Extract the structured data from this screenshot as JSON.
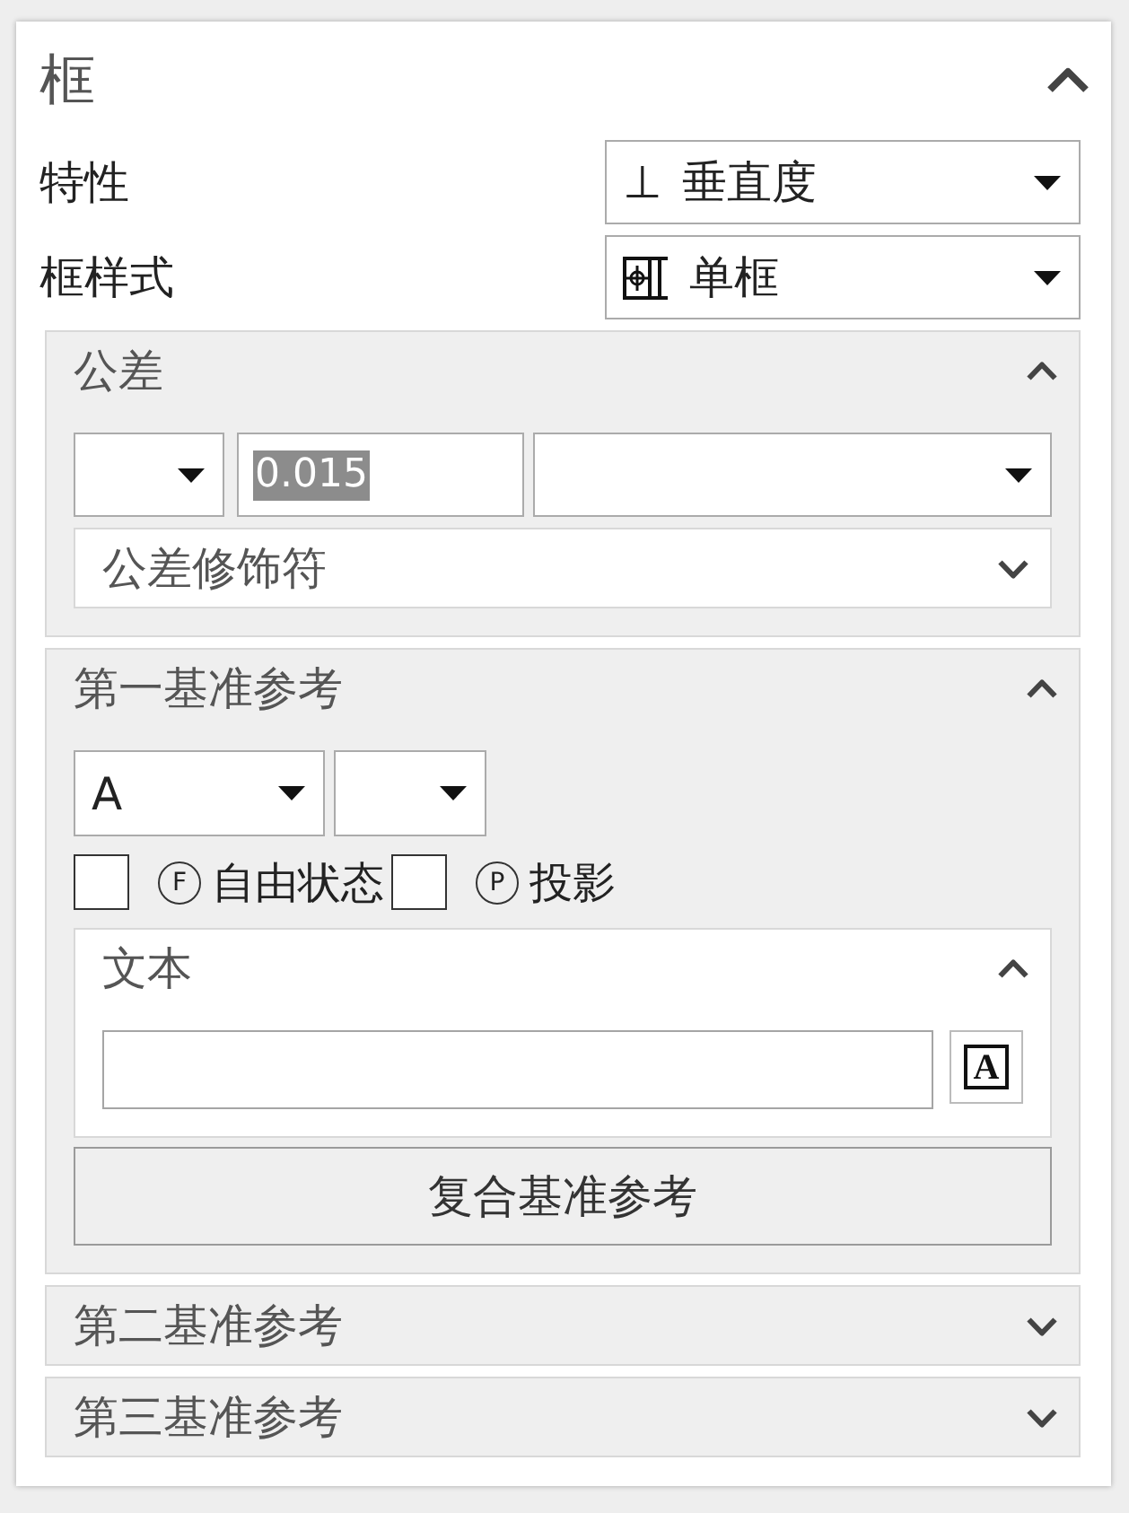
{
  "panel": {
    "title": "框",
    "expanded": true
  },
  "fields": [
    {
      "label": "特性",
      "kind": "symbol",
      "symbol": "⊥",
      "value": "垂直度"
    },
    {
      "label": "框样式",
      "kind": "icon",
      "value": "单框"
    }
  ],
  "tolerance": {
    "title": "公差",
    "expanded": true,
    "value": "0.015",
    "value_selected": true,
    "modifiers": {
      "title": "公差修饰符",
      "expanded": false
    }
  },
  "datums": [
    {
      "title": "第一基准参考",
      "expanded": true,
      "letter": "A",
      "checkboxes": [
        {
          "symbol": "F",
          "label": "自由状态",
          "checked": false
        },
        {
          "symbol": "P",
          "label": "投影",
          "checked": false
        }
      ],
      "text": {
        "title": "文本",
        "expanded": true,
        "symbol_button": "A"
      },
      "button": "复合基准参考"
    },
    {
      "title": "第二基准参考",
      "expanded": false
    },
    {
      "title": "第三基准参考",
      "expanded": false
    }
  ]
}
